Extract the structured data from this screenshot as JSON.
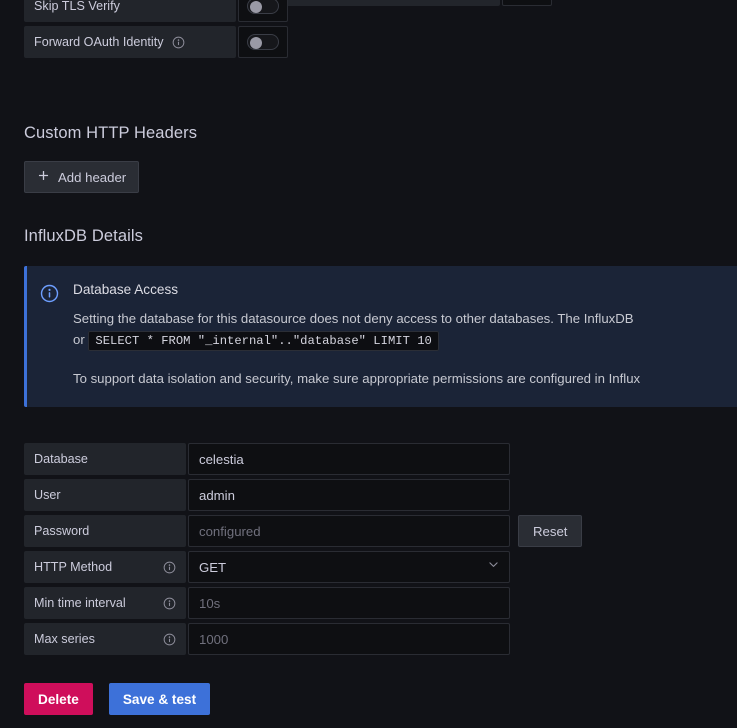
{
  "tls_section": {
    "rows": [
      {
        "label": "Skip TLS Verify",
        "has_info": false,
        "toggle_on": false
      },
      {
        "label": "Forward OAuth Identity",
        "has_info": true,
        "toggle_on": false
      }
    ]
  },
  "custom_headers": {
    "title": "Custom HTTP Headers",
    "add_button": "Add header",
    "plus_icon": "plus-icon"
  },
  "influx_details": {
    "title": "InfluxDB Details"
  },
  "alert": {
    "icon": "info-circle-icon",
    "title": "Database Access",
    "paragraph_1_before": "Setting the database for this datasource does not deny access to other databases. The InfluxDB ",
    "code": "SELECT * FROM \"_internal\"..\"database\" LIMIT 10",
    "paragraph_1_or": "or ",
    "paragraph_2": "To support data isolation and security, make sure appropriate permissions are configured in Influx",
    "accent_color": "#3d71d9",
    "background_color": "#1b2437"
  },
  "fields": {
    "database": {
      "label": "Database",
      "value": "celestia",
      "placeholder": "",
      "has_info": false
    },
    "user": {
      "label": "User",
      "value": "admin",
      "placeholder": "",
      "has_info": false
    },
    "password": {
      "label": "Password",
      "value": "",
      "placeholder": "configured",
      "has_info": false,
      "reset_label": "Reset"
    },
    "http_method": {
      "label": "HTTP Method",
      "value": "GET",
      "has_info": true,
      "chevron_icon": "chevron-down-icon"
    },
    "min_time_interval": {
      "label": "Min time interval",
      "value": "",
      "placeholder": "10s",
      "has_info": true
    },
    "max_series": {
      "label": "Max series",
      "value": "",
      "placeholder": "1000",
      "has_info": true
    }
  },
  "actions": {
    "delete_label": "Delete",
    "save_label": "Save & test",
    "delete_color": "#cf0e5b",
    "save_color": "#3d71d9"
  }
}
